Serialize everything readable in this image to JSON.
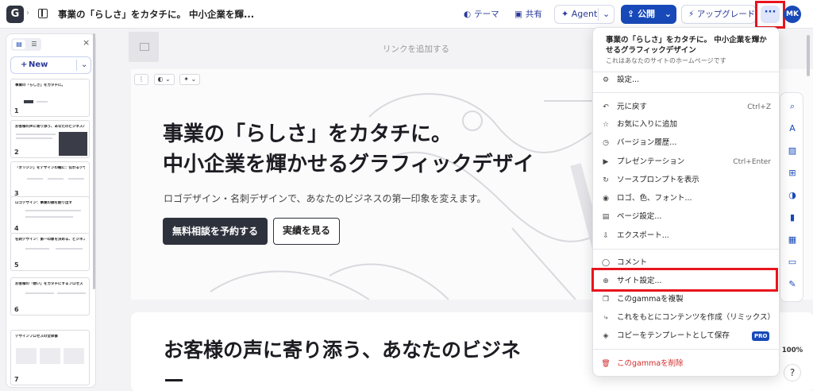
{
  "topbar": {
    "logo": "G",
    "doc_title": "事業の「らしさ」をカタチに。 中小企業を輝...",
    "theme_label": "テーマ",
    "share_label": "共有",
    "agent_label": "Agent",
    "publish_label": "公開",
    "upgrade_label": "アップグレード",
    "more_label": "···",
    "avatar_initials": "MK"
  },
  "left_panel": {
    "new_label": "New",
    "close_label": "×",
    "slides": [
      {
        "num": "1",
        "title": "事業の「らしさ」をカタチに。"
      },
      {
        "num": "2",
        "title": "お客様の声に寄り添う、あなたのビジネスパートナー"
      },
      {
        "num": "3",
        "title": "「オリジン」をデザインの軸に：伝わるデザインの秘密"
      },
      {
        "num": "4",
        "title": "ロゴデザイン：事業の顔を創り出す"
      },
      {
        "num": "5",
        "title": "名刺デザイン：第一印象を決める、ビジネスの顔"
      },
      {
        "num": "6",
        "title": "お客様の「想い」をカタチにするプロセス"
      },
      {
        "num": "7",
        "title": "デザインプロセスの全体像"
      }
    ]
  },
  "main": {
    "link_placeholder": "リンクを追加する",
    "hero_title_line1": "事業の「らしさ」をカタチに。",
    "hero_title_line2": "中小企業を輝かせるグラフィックデザイ",
    "hero_subtitle": "ロゴデザイン・名刺デザインで、あなたのビジネスの第一印象を変えます。",
    "cta_primary": "無料相談を予約する",
    "cta_secondary": "実績を見る",
    "section2_title": "お客様の声に寄り添う、あなたのビジネ"
  },
  "menu": {
    "header_title": "事業の「らしさ」をカタチに。 中小企業を輝かせるグラフィックデザイン",
    "header_sub": "これはあなたのサイトのホームページです",
    "items": [
      {
        "label": "設定...",
        "icon": "⚙",
        "shortcut": ""
      },
      {
        "label": "元に戻す",
        "icon": "↶",
        "shortcut": "Ctrl+Z"
      },
      {
        "label": "お気に入りに追加",
        "icon": "☆",
        "shortcut": ""
      },
      {
        "label": "バージョン履歴...",
        "icon": "◷",
        "shortcut": ""
      },
      {
        "label": "プレゼンテーション",
        "icon": "▶",
        "shortcut": "Ctrl+Enter"
      },
      {
        "label": "ソースプロンプトを表示",
        "icon": "↻",
        "shortcut": ""
      },
      {
        "label": "ロゴ、色、フォント...",
        "icon": "◉",
        "shortcut": ""
      },
      {
        "label": "ページ設定...",
        "icon": "▤",
        "shortcut": ""
      },
      {
        "label": "エクスポート...",
        "icon": "⇩",
        "shortcut": ""
      },
      {
        "label": "コメント",
        "icon": "◯",
        "shortcut": ""
      },
      {
        "label": "サイト設定...",
        "icon": "⊕",
        "shortcut": ""
      },
      {
        "label": "このgammaを複製",
        "icon": "❐",
        "shortcut": ""
      },
      {
        "label": "これをもとにコンテンツを作成（リミックス）",
        "icon": "⤷",
        "shortcut": ""
      },
      {
        "label": "コピーをテンプレートとして保存",
        "icon": "◈",
        "shortcut": "",
        "badge": "PRO"
      },
      {
        "label": "このgammaを削除",
        "icon": "🗑",
        "shortcut": ""
      }
    ]
  },
  "zoom_label": "100%",
  "help_label": "?",
  "colors": {
    "accent": "#1849b8",
    "highlight": "#e8141d",
    "danger": "#d12a2a"
  }
}
